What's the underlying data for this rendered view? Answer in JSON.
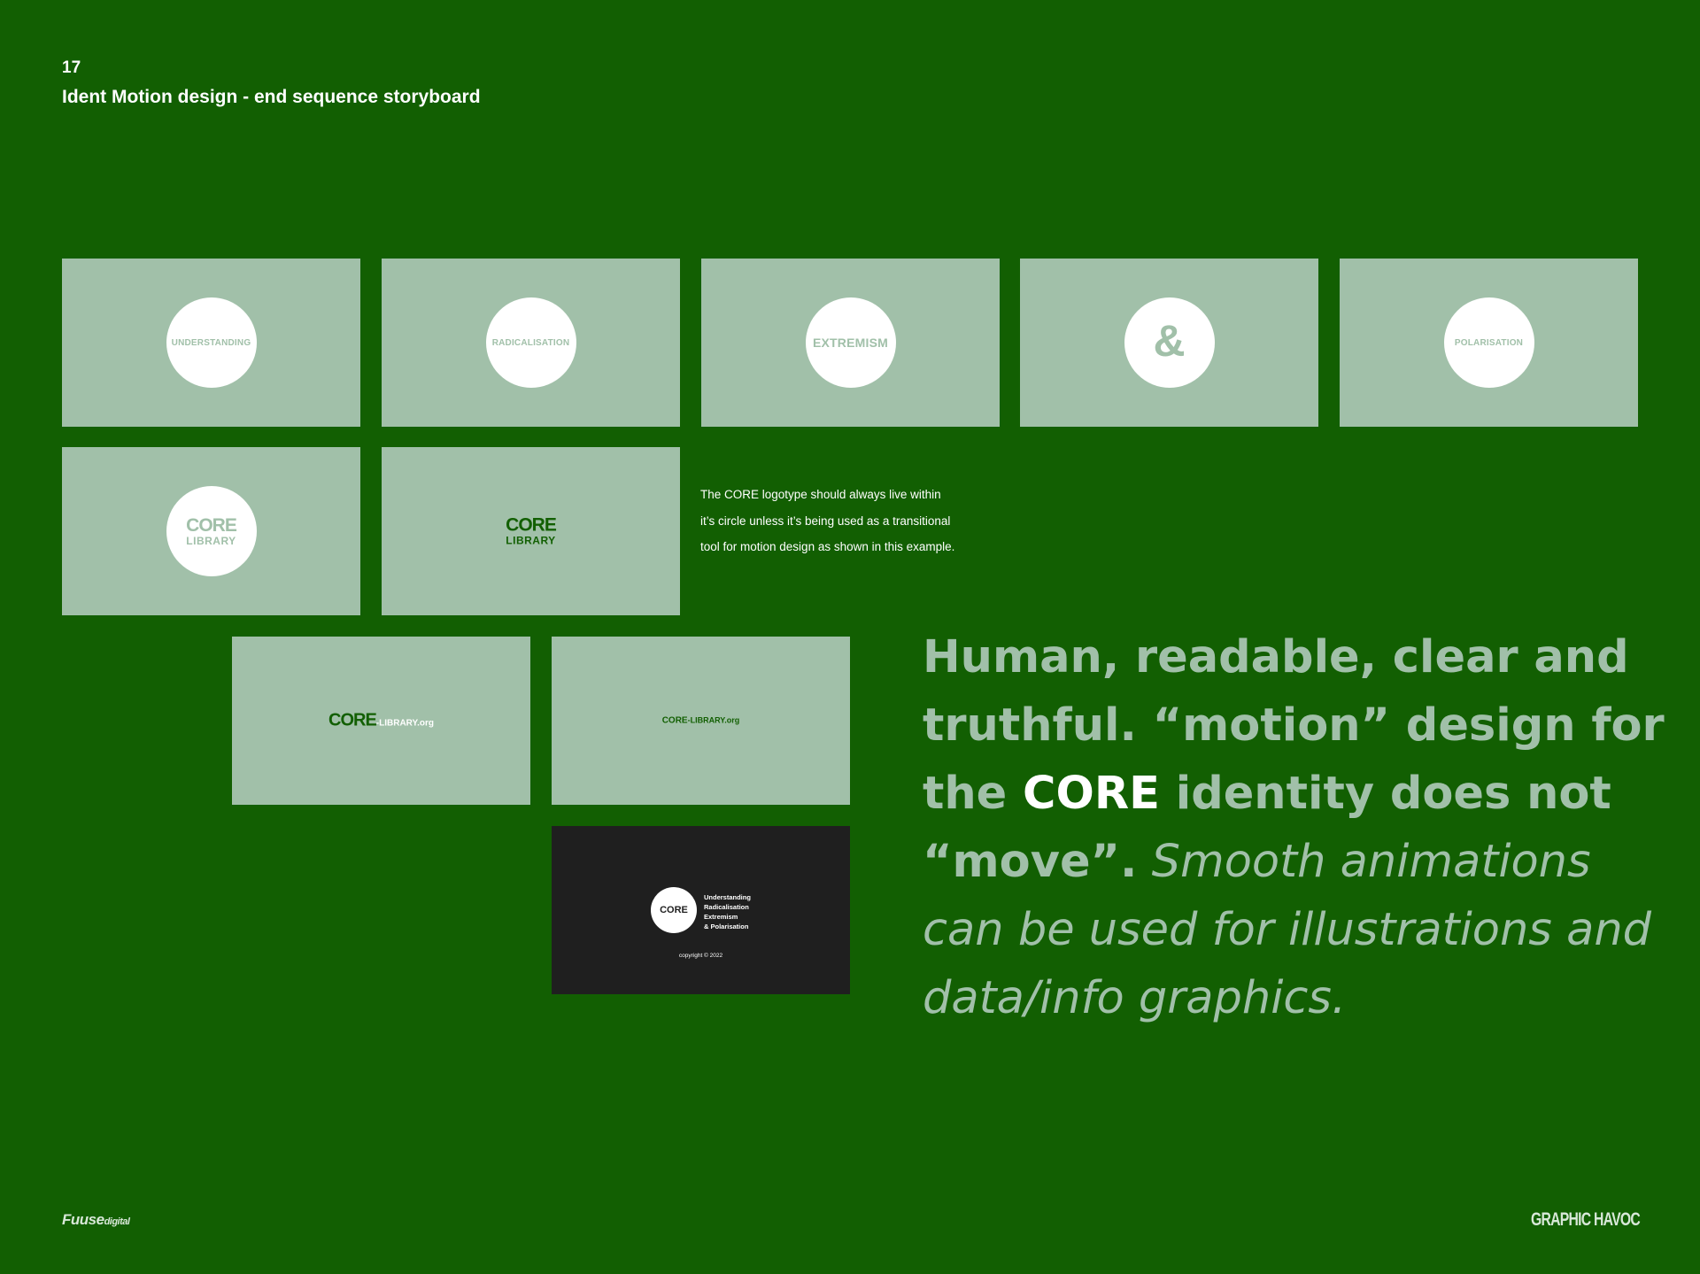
{
  "header": {
    "page_number": "17",
    "title": "Ident Motion design - end sequence storyboard"
  },
  "frames": {
    "f1_word": "UNDERSTANDING",
    "f2_word": "RADICALISATION",
    "f3_word": "EXTREMISM",
    "f4_word": "&",
    "f5_word": "POLARISATION",
    "f6_core": "CORE",
    "f6_library": "LIBRARY",
    "f7_core": "CORE",
    "f7_library": "LIBRARY",
    "f8_core": "CORE",
    "f8_domain": "-LIBRARY.org",
    "f9_core": "CORE",
    "f9_domain": "-LIBRARY.org",
    "f10_core": "CORE",
    "f10_list": [
      "Understanding",
      "Radicalisation",
      "Extremism",
      "& Polarisation"
    ],
    "f10_copyright": "copyright © 2022"
  },
  "note": "The CORE logotype should always live within it’s circle unless it’s being used as a transitional tool for motion design as shown in this example.",
  "quote": {
    "part1": "Human, readable, clear and truthful. “motion” design for the ",
    "highlight": "CORE",
    "part2": " identity does not “move”.",
    "part3": " Smooth animations can be used for illustrations and data/info graphics."
  },
  "footer": {
    "left_main": "Fuuse",
    "left_sub": "digital",
    "right": "GRAPHIC HAVOC"
  },
  "colors": {
    "background": "#125f02",
    "frame": "#a1c0a9",
    "dark_frame": "#1f1f1f"
  }
}
